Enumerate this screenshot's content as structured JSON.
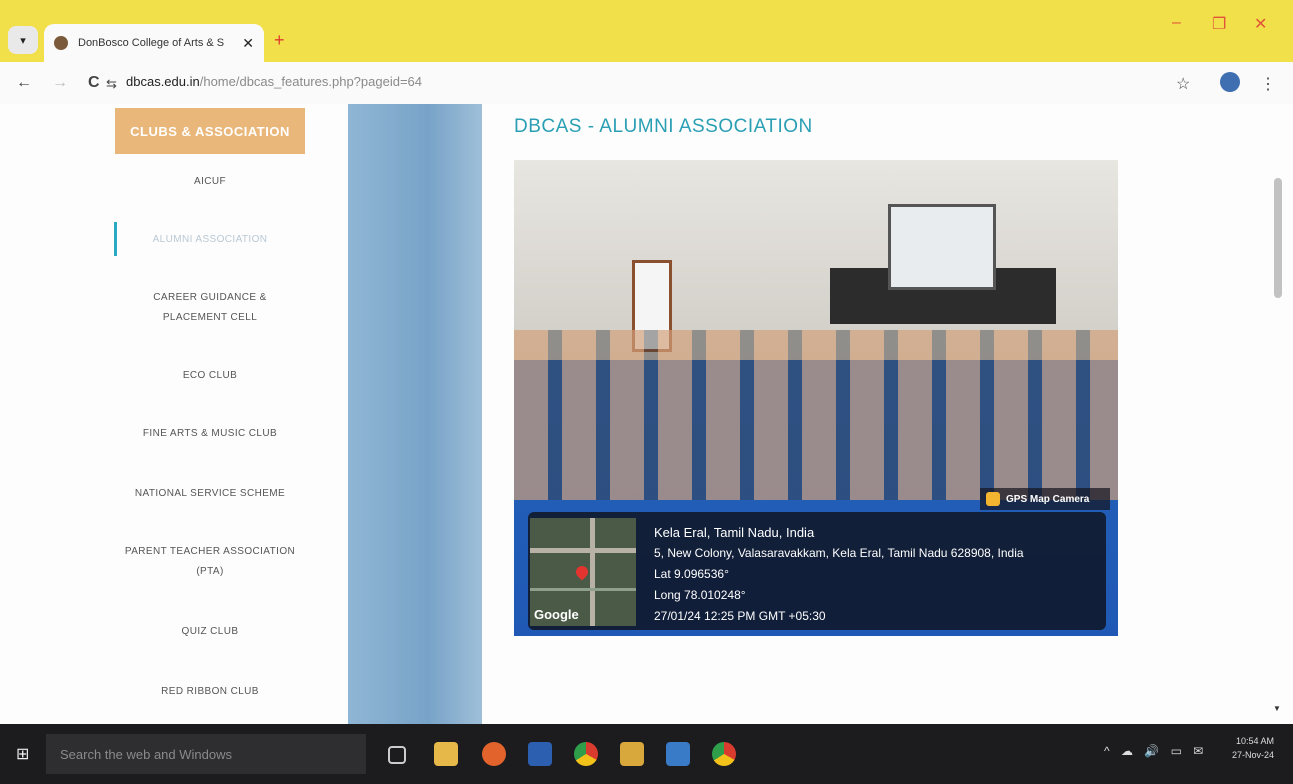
{
  "browser": {
    "tab_title": "DonBosco College of Arts & S",
    "tab_close": "✕",
    "new_tab": "+",
    "url_host": "dbcas.edu.in",
    "url_path": "/home/dbcas_features.php?pageid=64",
    "back": "←",
    "forward": "→",
    "reload": "C",
    "site_info": "⇆",
    "bookmark": "☆",
    "menu": "⋮",
    "minimize": "–",
    "restore": "❐",
    "close": "✕"
  },
  "sidebar": {
    "header": "CLUBS & ASSOCIATION",
    "items": [
      {
        "label": "AICUF",
        "label2": ""
      },
      {
        "label": "ALUMNI ASSOCIATION",
        "label2": ""
      },
      {
        "label": "CAREER GUIDANCE &",
        "label2": "PLACEMENT CELL"
      },
      {
        "label": "ECO CLUB",
        "label2": ""
      },
      {
        "label": "FINE ARTS & MUSIC CLUB",
        "label2": ""
      },
      {
        "label": "NATIONAL SERVICE SCHEME",
        "label2": ""
      },
      {
        "label": "PARENT TEACHER ASSOCIATION",
        "label2": "(PTA)"
      },
      {
        "label": "QUIZ CLUB",
        "label2": ""
      },
      {
        "label": "RED RIBBON CLUB",
        "label2": ""
      }
    ]
  },
  "main": {
    "heading": "DBCAS - ALUMNI ASSOCIATION",
    "photo": {
      "badge": "GPS Map Camera",
      "map_label": "Google",
      "location": "Kela Eral, Tamil Nadu, India",
      "address": "5, New Colony, Valasaravakkam, Kela Eral, Tamil Nadu 628908, India",
      "lat": "Lat 9.096536°",
      "long": "Long 78.010248°",
      "datetime": "27/01/24 12:25 PM GMT +05:30"
    }
  },
  "taskbar": {
    "search_placeholder": "Search the web and Windows",
    "time": "10:54 AM",
    "date": "27-Nov-24",
    "tray_icons": "^ ☁ 🔊 ▭ ✉"
  },
  "colors": {
    "title_bar": "#f2e04a",
    "heading": "#2a9fb4",
    "sidebar_header_bg": "#eab77a",
    "active_bar": "#2aa9c5"
  }
}
